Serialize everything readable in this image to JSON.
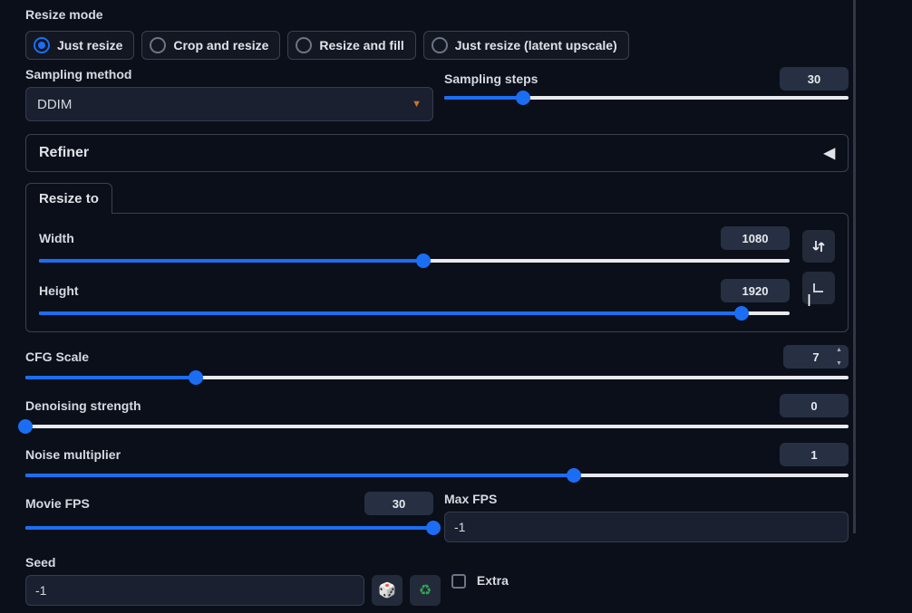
{
  "resize_mode": {
    "label": "Resize mode",
    "options": [
      "Just resize",
      "Crop and resize",
      "Resize and fill",
      "Just resize (latent upscale)"
    ],
    "selected": 0
  },
  "sampling_method": {
    "label": "Sampling method",
    "value": "DDIM"
  },
  "sampling_steps": {
    "label": "Sampling steps",
    "value": 30,
    "min": 1,
    "max": 150
  },
  "refiner": {
    "label": "Refiner"
  },
  "resize_to": {
    "tab": "Resize to",
    "width": {
      "label": "Width",
      "value": 1080,
      "min": 64,
      "max": 2048
    },
    "height": {
      "label": "Height",
      "value": 1920,
      "min": 64,
      "max": 2048
    }
  },
  "cfg_scale": {
    "label": "CFG Scale",
    "value": 7,
    "min": 1,
    "max": 30
  },
  "denoising": {
    "label": "Denoising strength",
    "value": 0,
    "min": 0,
    "max": 1
  },
  "noise_mult": {
    "label": "Noise multiplier",
    "value": 1,
    "min": 0,
    "max": 1.5
  },
  "movie_fps": {
    "label": "Movie FPS",
    "value": 30,
    "min": 1,
    "max": 30
  },
  "max_fps": {
    "label": "Max FPS",
    "value": "-1"
  },
  "seed": {
    "label": "Seed",
    "value": "-1"
  },
  "extra": {
    "label": "Extra",
    "checked": false
  },
  "icons": {
    "swap": "swap-icon",
    "ruler": "ruler-icon",
    "dice": "🎲",
    "recycle": "♻"
  }
}
